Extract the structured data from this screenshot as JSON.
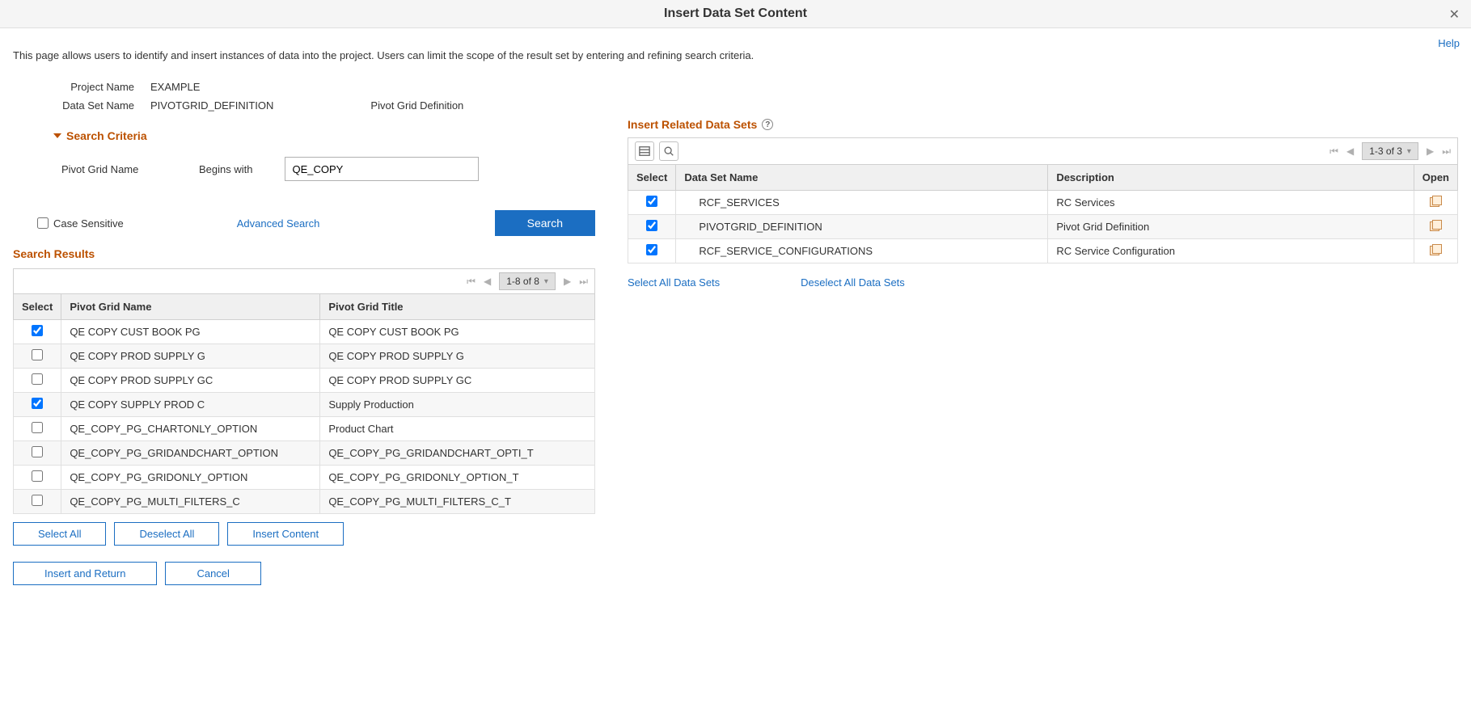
{
  "header": {
    "title": "Insert Data Set Content",
    "help": "Help"
  },
  "page": {
    "description": "This page allows users to identify and insert instances of data into the project. Users can limit the scope of the result set by entering and refining search criteria.",
    "fields": {
      "project_name_label": "Project Name",
      "project_name_value": "EXAMPLE",
      "dataset_name_label": "Data Set Name",
      "dataset_name_value": "PIVOTGRID_DEFINITION",
      "dataset_desc_value": "Pivot Grid Definition"
    }
  },
  "search": {
    "section_title": "Search Criteria",
    "field_label": "Pivot Grid Name",
    "operator_label": "Begins with",
    "value": "QE_COPY",
    "case_sensitive_label": "Case Sensitive",
    "advanced_link": "Advanced Search",
    "search_button": "Search"
  },
  "results": {
    "section_title": "Search Results",
    "pager_range": "1-8 of 8",
    "columns": {
      "select": "Select",
      "name": "Pivot Grid Name",
      "title": "Pivot Grid Title"
    },
    "rows": [
      {
        "selected": true,
        "name": "QE COPY CUST BOOK PG",
        "title": "QE COPY CUST BOOK PG"
      },
      {
        "selected": false,
        "name": "QE COPY PROD SUPPLY G",
        "title": "QE COPY PROD SUPPLY G"
      },
      {
        "selected": false,
        "name": "QE COPY PROD SUPPLY GC",
        "title": "QE COPY PROD SUPPLY GC"
      },
      {
        "selected": true,
        "name": "QE COPY SUPPLY PROD C",
        "title": "Supply Production"
      },
      {
        "selected": false,
        "name": "QE_COPY_PG_CHARTONLY_OPTION",
        "title": "Product Chart"
      },
      {
        "selected": false,
        "name": "QE_COPY_PG_GRIDANDCHART_OPTION",
        "title": "QE_COPY_PG_GRIDANDCHART_OPTI_T"
      },
      {
        "selected": false,
        "name": "QE_COPY_PG_GRIDONLY_OPTION",
        "title": "QE_COPY_PG_GRIDONLY_OPTION_T"
      },
      {
        "selected": false,
        "name": "QE_COPY_PG_MULTI_FILTERS_C",
        "title": "QE_COPY_PG_MULTI_FILTERS_C_T"
      }
    ],
    "buttons": {
      "select_all": "Select All",
      "deselect_all": "Deselect All",
      "insert_content": "Insert Content",
      "insert_and_return": "Insert and Return",
      "cancel": "Cancel"
    }
  },
  "related": {
    "section_title": "Insert Related Data Sets",
    "pager_range": "1-3 of 3",
    "columns": {
      "select": "Select",
      "name": "Data Set Name",
      "desc": "Description",
      "open": "Open"
    },
    "rows": [
      {
        "selected": true,
        "name": "RCF_SERVICES",
        "desc": "RC Services"
      },
      {
        "selected": true,
        "name": "PIVOTGRID_DEFINITION",
        "desc": "Pivot Grid Definition"
      },
      {
        "selected": true,
        "name": "RCF_SERVICE_CONFIGURATIONS",
        "desc": "RC Service Configuration"
      }
    ],
    "links": {
      "select_all": "Select All Data Sets",
      "deselect_all": "Deselect All Data Sets"
    }
  }
}
